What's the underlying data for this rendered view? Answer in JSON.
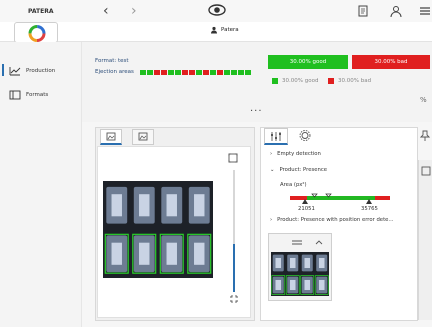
{
  "app": {
    "brand": "PATERA",
    "user": "Patera"
  },
  "sidebar": {
    "items": [
      {
        "label": "Production",
        "active": true
      },
      {
        "label": "Formats",
        "active": false
      }
    ]
  },
  "header": {
    "format_label": "Format: test",
    "ejection_label": "Ejection areas",
    "ejection_pattern": [
      "green",
      "green",
      "red",
      "red",
      "green",
      "green",
      "red",
      "red",
      "green",
      "red",
      "green",
      "red",
      "green",
      "green",
      "green",
      "green"
    ],
    "good_button": "30.00% good",
    "bad_button": "30.00% bad",
    "legend_good": "30.00% good",
    "legend_bad": "30.00% bad",
    "more": "···"
  },
  "detection": {
    "empty_detection": "Empty detection",
    "product_presence": "Product: Presence",
    "area_label": "Area (px²)",
    "min_value": "21051",
    "max_value": "35765",
    "product_position": "Product: Presence with position error dete..."
  },
  "colors": {
    "good": "#1fbf1f",
    "bad": "#e01f1f",
    "accent": "#2a6fb0"
  },
  "icons": {
    "back": "chevron-left-icon",
    "forward": "chevron-right-icon",
    "eye": "eye-icon",
    "document": "document-icon",
    "user": "user-icon",
    "menu": "menu-icon"
  }
}
